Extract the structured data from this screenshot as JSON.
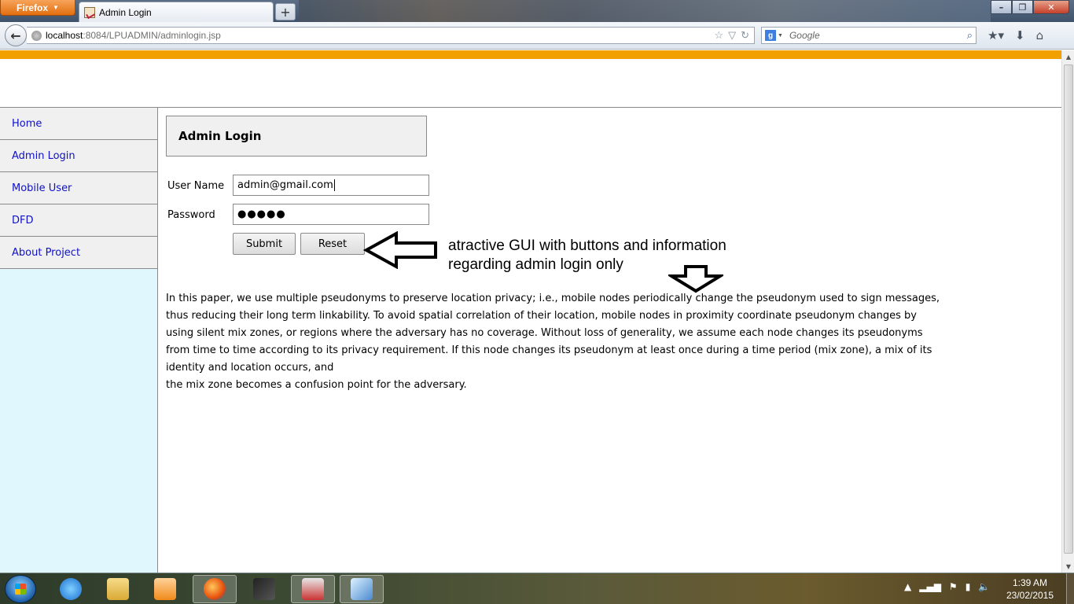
{
  "browser": {
    "app_button": "Firefox",
    "tab_title": "Admin Login",
    "url_host": "localhost",
    "url_rest": ":8084/LPUADMIN/adminlogin.jsp",
    "search_placeholder": "Google"
  },
  "colors": {
    "accent_bar": "#f29f00",
    "link": "#1010c8",
    "sidebar_bg": "#e0f7fd"
  },
  "sidebar": {
    "items": [
      {
        "label": "Home"
      },
      {
        "label": "Admin Login"
      },
      {
        "label": "Mobile User"
      },
      {
        "label": "DFD"
      },
      {
        "label": "About Project"
      }
    ]
  },
  "login": {
    "title": "Admin Login",
    "username_label": "User Name",
    "username_value": "admin@gmail.com",
    "password_label": "Password",
    "password_value": "●●●●●",
    "submit_label": "Submit",
    "reset_label": "Reset"
  },
  "annotation": {
    "line1": "atractive GUI with buttons and information",
    "line2": "regarding admin login only"
  },
  "content": {
    "paragraph": "In this paper, we use multiple pseudonyms to preserve location privacy; i.e., mobile nodes periodically change the pseudonym used to sign messages, thus reducing their long term linkability. To avoid spatial correlation of their location, mobile nodes in proximity coordinate pseudonym changes by using silent mix zones, or regions where the adversary has no coverage. Without loss of generality, we assume each node changes its pseudonyms from time to time according to its privacy requirement. If this node changes its pseudonym at least once during a time period (mix zone), a mix of its identity and location occurs, and",
    "paragraph_end": "the mix zone becomes a confusion point for the adversary."
  },
  "taskbar": {
    "time": "1:39 AM",
    "date": "23/02/2015"
  }
}
